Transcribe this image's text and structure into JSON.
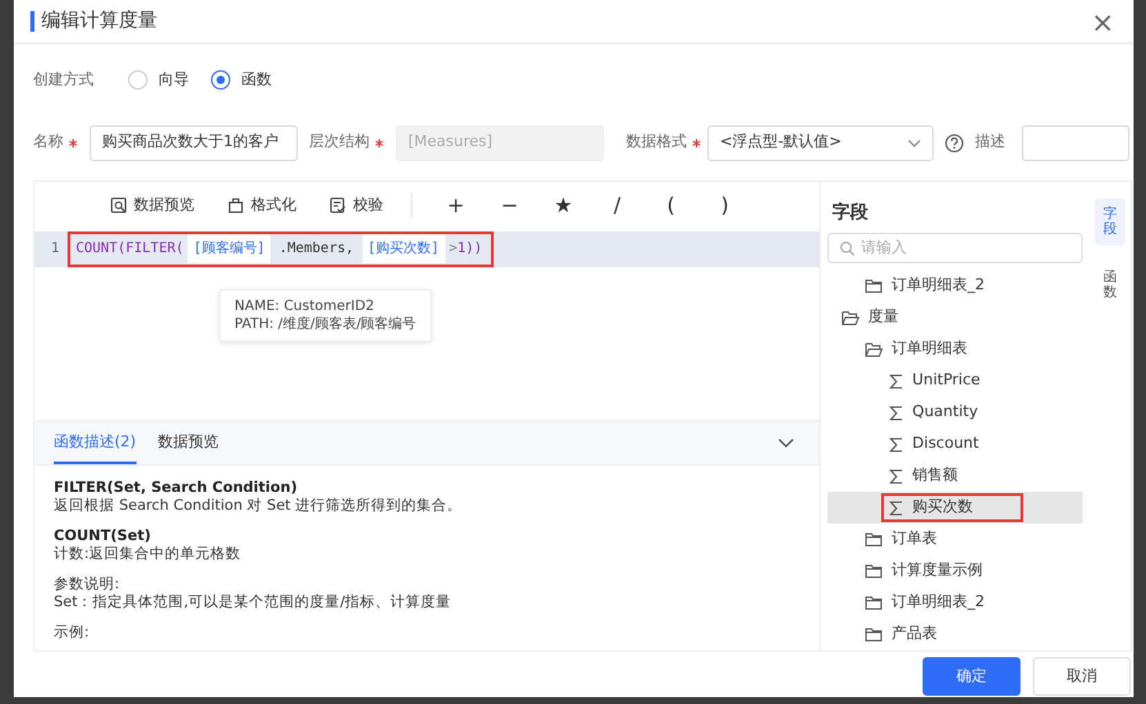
{
  "dialog": {
    "title": "编辑计算度量",
    "close": "×"
  },
  "create_mode": {
    "label": "创建方式",
    "options": [
      {
        "label": "向导",
        "selected": false
      },
      {
        "label": "函数",
        "selected": true
      }
    ]
  },
  "form": {
    "name": {
      "label": "名称",
      "required": true,
      "value": "购买商品次数大于1的客户"
    },
    "hierarchy": {
      "label": "层次结构",
      "required": true,
      "value": "[Measures]",
      "disabled": true
    },
    "format": {
      "label": "数据格式",
      "required": true,
      "value": "<浮点型-默认值>"
    },
    "description": {
      "label": "描述"
    }
  },
  "toolbar": {
    "actions": [
      {
        "label": "数据预览",
        "kind": "preview"
      },
      {
        "label": "格式化",
        "kind": "format"
      },
      {
        "label": "校验",
        "kind": "validate"
      }
    ],
    "operators": [
      "+",
      "−",
      "★",
      "/",
      "(",
      ")"
    ]
  },
  "editor": {
    "lines": [
      {
        "number": "1",
        "highlighted": true,
        "tokens": [
          {
            "text": "COUNT(FILTER(",
            "kind": "function"
          },
          {
            "text": "[顾客编号]",
            "kind": "field"
          },
          {
            "text": ".Members,",
            "kind": "plain"
          },
          {
            "text": "[购买次数]",
            "kind": "field"
          },
          {
            "text": ">",
            "kind": "operator"
          },
          {
            "text": "1)",
            "kind": "function"
          },
          {
            "text": ")",
            "kind": "function"
          }
        ]
      }
    ],
    "tooltip": [
      "NAME: CustomerID2",
      "PATH: /维度/顾客表/顾客编号"
    ]
  },
  "bottom_panel": {
    "tabs": [
      {
        "label": "函数描述(2)",
        "selected": true
      },
      {
        "label": "数据预览",
        "selected": false
      }
    ],
    "expanded": true,
    "blocks": [
      {
        "title": "FILTER(Set, Search Condition)",
        "lines": [
          "返回根据 Search Condition 对 Set 进行筛选所得到的集合。"
        ]
      },
      {
        "title": "COUNT(Set)",
        "lines": [
          "计数:返回集合中的单元格数"
        ]
      },
      {
        "lines": [
          "参数说明:",
          "Set：指定具体范围,可以是某个范围的度量/指标、计算度量"
        ]
      },
      {
        "lines": [
          "示例:"
        ]
      }
    ]
  },
  "fields_panel": {
    "title": "字段",
    "search": {
      "placeholder": "请输入"
    },
    "tree": {
      "continued_children": [
        {
          "label": "订单明细表_2",
          "kind": "folder",
          "expanded": false,
          "selected": false,
          "highlighted": false
        }
      ],
      "items": [
        {
          "label": "度量",
          "kind": "folder",
          "expanded": true,
          "selected": false,
          "highlighted": false,
          "children": [
            {
              "label": "订单明细表",
              "kind": "folder",
              "expanded": true,
              "selected": false,
              "highlighted": false,
              "children": [
                {
                  "label": "UnitPrice",
                  "kind": "measure",
                  "selected": false,
                  "highlighted": false
                },
                {
                  "label": "Quantity",
                  "kind": "measure",
                  "selected": false,
                  "highlighted": false
                },
                {
                  "label": "Discount",
                  "kind": "measure",
                  "selected": false,
                  "highlighted": false
                },
                {
                  "label": "销售额",
                  "kind": "measure",
                  "selected": false,
                  "highlighted": false
                },
                {
                  "label": "购买次数",
                  "kind": "measure",
                  "selected": true,
                  "highlighted": true
                }
              ]
            },
            {
              "label": "订单表",
              "kind": "folder",
              "expanded": false,
              "selected": false,
              "highlighted": false
            },
            {
              "label": "计算度量示例",
              "kind": "folder",
              "expanded": false,
              "selected": false,
              "highlighted": false
            },
            {
              "label": "订单明细表_2",
              "kind": "folder",
              "expanded": false,
              "selected": false,
              "highlighted": false
            },
            {
              "label": "产品表",
              "kind": "folder",
              "expanded": false,
              "selected": false,
              "highlighted": false
            }
          ]
        }
      ]
    }
  },
  "side_tabs": [
    {
      "label": "字段",
      "selected": true
    },
    {
      "label": "函数",
      "selected": false
    }
  ],
  "buttons": [
    {
      "label": "确定",
      "kind": "primary"
    },
    {
      "label": "取消",
      "kind": "secondary"
    }
  ]
}
